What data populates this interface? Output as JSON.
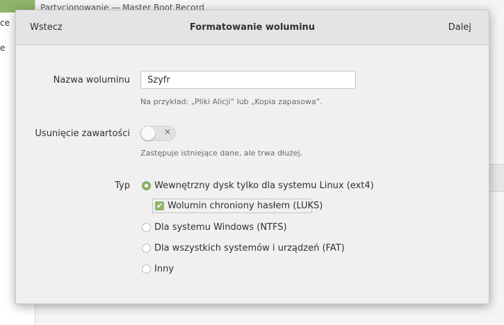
{
  "background": {
    "sidebar_items": [
      "ce",
      "e"
    ],
    "topline": "Partycjonowanie — Master Boot Record"
  },
  "dialog": {
    "back_label": "Wstecz",
    "title": "Formatowanie woluminu",
    "next_label": "Dalej",
    "volume_name": {
      "label": "Nazwa woluminu",
      "value": "Szyfr",
      "hint": "Na przykład: „Pliki Alicji” lub „Kopia zapasowa”."
    },
    "erase": {
      "label": "Usunięcie zawartości",
      "enabled": false,
      "hint": "Zastępuje istniejące dane, ale trwa dłużej."
    },
    "type": {
      "label": "Typ",
      "options": [
        {
          "label": "Wewnętrzny dysk tylko dla systemu Linux (ext4)",
          "selected": true
        },
        {
          "label": "Dla systemu Windows (NTFS)",
          "selected": false
        },
        {
          "label": "Dla wszystkich systemów i urządzeń (FAT)",
          "selected": false
        },
        {
          "label": "Inny",
          "selected": false
        }
      ],
      "luks": {
        "label": "Wolumin chroniony hasłem (LUKS)",
        "checked": true
      }
    }
  },
  "colors": {
    "accent": "#8fb46a",
    "dialog_bg": "#f0f0f0",
    "header_bg": "#e4e4e4"
  }
}
